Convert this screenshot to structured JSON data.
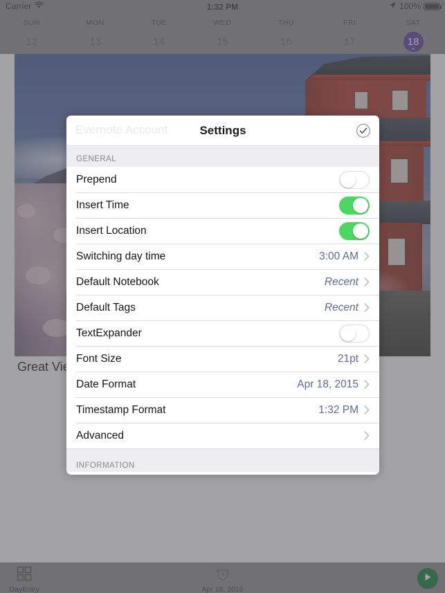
{
  "status_bar": {
    "carrier": "Carrier",
    "wifi_icon": "wifi-icon",
    "time": "1:32 PM",
    "location_icon": "location-arrow-icon",
    "battery_percent": "100%",
    "battery_icon": "battery-full-icon"
  },
  "week_strip": {
    "days": [
      {
        "dow": "SUN",
        "num": "12",
        "selected": false
      },
      {
        "dow": "MON",
        "num": "13",
        "selected": false
      },
      {
        "dow": "TUE",
        "num": "14",
        "selected": false
      },
      {
        "dow": "WED",
        "num": "15",
        "selected": false
      },
      {
        "dow": "THU",
        "num": "16",
        "selected": false
      },
      {
        "dow": "FRI",
        "num": "17",
        "selected": false
      },
      {
        "dow": "SAT",
        "num": "18",
        "selected": true
      }
    ],
    "selected_color": "#5d3f9e"
  },
  "entry": {
    "caption": "Great Vie"
  },
  "modal": {
    "ghost_text": "Evernote Account",
    "title": "Settings",
    "done_icon": "checkmark-circle-icon",
    "sections": [
      {
        "header": "GENERAL",
        "rows": [
          {
            "label": "Prepend",
            "type": "toggle",
            "state": "off"
          },
          {
            "label": "Insert Time",
            "type": "toggle",
            "state": "on"
          },
          {
            "label": "Insert Location",
            "type": "toggle",
            "state": "on"
          },
          {
            "label": "Switching day time",
            "type": "disclosure",
            "value": "3:00 AM",
            "italic": false
          },
          {
            "label": "Default Notebook",
            "type": "disclosure",
            "value": "Recent",
            "italic": true
          },
          {
            "label": "Default Tags",
            "type": "disclosure",
            "value": "Recent",
            "italic": true
          },
          {
            "label": "TextExpander",
            "type": "toggle",
            "state": "off"
          },
          {
            "label": "Font Size",
            "type": "disclosure",
            "value": "21pt",
            "italic": false
          },
          {
            "label": "Date Format",
            "type": "disclosure",
            "value": "Apr 18, 2015",
            "italic": false
          },
          {
            "label": "Timestamp Format",
            "type": "disclosure",
            "value": "1:32 PM",
            "italic": false
          },
          {
            "label": "Advanced",
            "type": "disclosure",
            "value": "",
            "italic": false
          }
        ]
      },
      {
        "header": "INFORMATION",
        "rows": []
      }
    ],
    "toggle_on_color": "#4cd763",
    "value_color": "#5b6b93"
  },
  "toolbar": {
    "left_icon": "grid-icon",
    "left_label": "DayEntry",
    "center_icon": "alarm-clock-icon",
    "center_label": "Apr 18, 2015",
    "play_icon": "play-icon",
    "play_color": "#127c36"
  }
}
